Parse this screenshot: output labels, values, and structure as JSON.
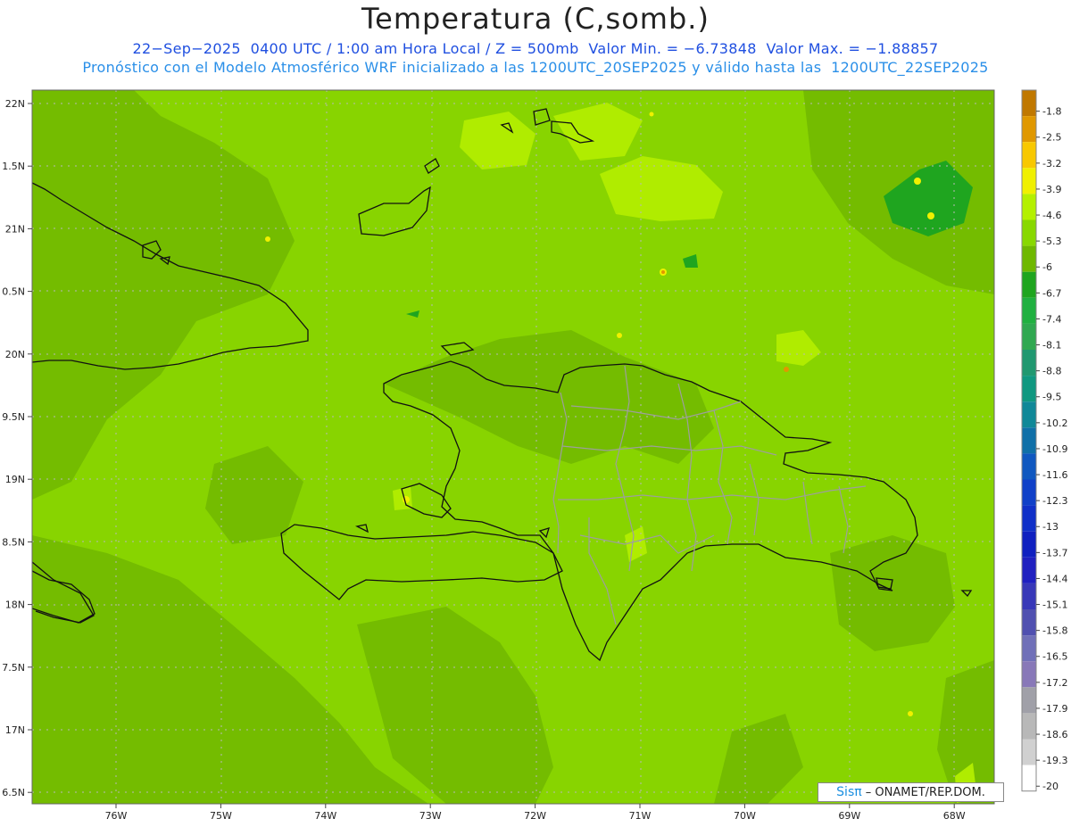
{
  "header": {
    "title": "Temperatura (C,somb.)",
    "line1": "22−Sep−2025  0400 UTC / 1:00 am Hora Local / Z = 500mb  Valor Min. = −6.73848  Valor Max. = −1.88857",
    "line2": "Pronóstico con el Modelo Atmosférico WRF inicializado a las 1200UTC_20SEP2025 y válido hasta las  1200UTC_22SEP2025"
  },
  "axes": {
    "lat_labels": [
      "22N",
      "1.5N",
      "21N",
      "0.5N",
      "20N",
      "9.5N",
      "19N",
      "8.5N",
      "18N",
      "7.5N",
      "17N",
      "6.5N"
    ],
    "lon_labels": [
      "76W",
      "75W",
      "74W",
      "73W",
      "72W",
      "71W",
      "70W",
      "69W",
      "68W"
    ]
  },
  "legend": {
    "labels": [
      "-1.8",
      "-2.5",
      "-3.2",
      "-3.9",
      "-4.6",
      "-5.3",
      "-6",
      "-6.7",
      "-7.4",
      "-8.1",
      "-8.8",
      "-9.5",
      "-10.2",
      "-10.9",
      "-11.6",
      "-12.3",
      "-13",
      "-13.7",
      "-14.4",
      "-15.1",
      "-15.8",
      "-16.5",
      "-17.2",
      "-17.9",
      "-18.6",
      "-19.3",
      "-20"
    ],
    "colors": [
      "#c07800",
      "#e09800",
      "#f8c800",
      "#f0f000",
      "#b4f000",
      "#88d800",
      "#6fb800",
      "#1fa51f",
      "#20b040",
      "#30a850",
      "#209870",
      "#109880",
      "#108898",
      "#1070a8",
      "#1058c0",
      "#1040c8",
      "#1030c8",
      "#1020c0",
      "#2020c0",
      "#3838b8",
      "#5050b0",
      "#7070b8",
      "#8878b8",
      "#a0a0a8",
      "#b8b8b8",
      "#d0d0d0",
      "#ffffff"
    ]
  },
  "colors": {
    "field_base": "#88d400",
    "field_dark": "#74bc00",
    "field_light": "#b0ec00",
    "field_deep": "#1fa51f"
  },
  "credit": {
    "brand": "Sisπ",
    "text": " – ONAMET/REP.DOM."
  }
}
